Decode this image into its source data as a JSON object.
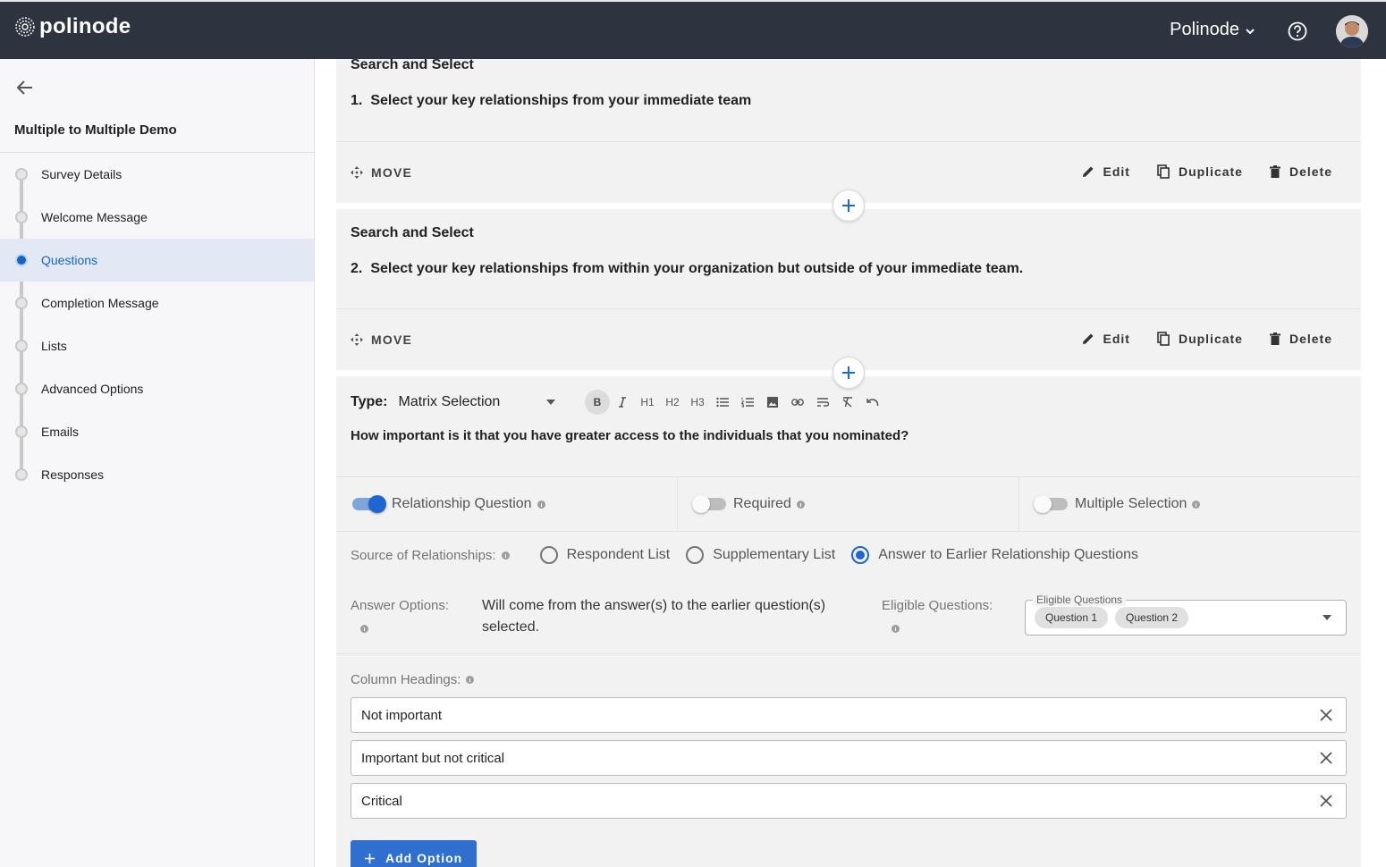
{
  "header": {
    "brand": "polinode",
    "org_name": "Polinode"
  },
  "sidebar": {
    "survey_title": "Multiple to Multiple Demo",
    "items": [
      {
        "label": "Survey Details"
      },
      {
        "label": "Welcome Message"
      },
      {
        "label": "Questions"
      },
      {
        "label": "Completion Message"
      },
      {
        "label": "Lists"
      },
      {
        "label": "Advanced Options"
      },
      {
        "label": "Emails"
      },
      {
        "label": "Responses"
      }
    ],
    "active_index": 2
  },
  "questions": [
    {
      "type": "Search and Select",
      "number": "1.",
      "text": "Select your key relationships from your immediate team"
    },
    {
      "type": "Search and Select",
      "number": "2.",
      "text": "Select your key relationships from within your organization but outside of your immediate team."
    }
  ],
  "actions": {
    "move": "MOVE",
    "edit": "Edit",
    "duplicate": "Duplicate",
    "delete": "Delete"
  },
  "editor": {
    "type_label": "Type:",
    "type_value": "Matrix Selection",
    "toolbar": {
      "bold": "B",
      "h1": "H1",
      "h2": "H2",
      "h3": "H3"
    },
    "question_text": "How important is it that you have greater access to the individuals that you nominated?",
    "toggles": [
      {
        "label": "Relationship Question",
        "on": true
      },
      {
        "label": "Required",
        "on": false
      },
      {
        "label": "Multiple Selection",
        "on": false
      }
    ],
    "source_label": "Source of Relationships:",
    "source_options": [
      {
        "label": "Respondent List",
        "checked": false
      },
      {
        "label": "Supplementary List",
        "checked": false
      },
      {
        "label": "Answer to Earlier Relationship Questions",
        "checked": true
      }
    ],
    "answer_options_label": "Answer Options:",
    "answer_options_text": "Will come from the answer(s) to the earlier question(s) selected.",
    "eligible_label": "Eligible Questions:",
    "eligible_field_label": "Eligible Questions",
    "eligible_chips": [
      "Question 1",
      "Question 2"
    ],
    "column_headings_label": "Column Headings:",
    "column_headings": [
      "Not important",
      "Important but not critical",
      "Critical"
    ],
    "add_option_label": "Add Option"
  },
  "colors": {
    "topbar": "#2d3440",
    "accent": "#1e66d0",
    "active_bg": "#e3e9f4"
  }
}
